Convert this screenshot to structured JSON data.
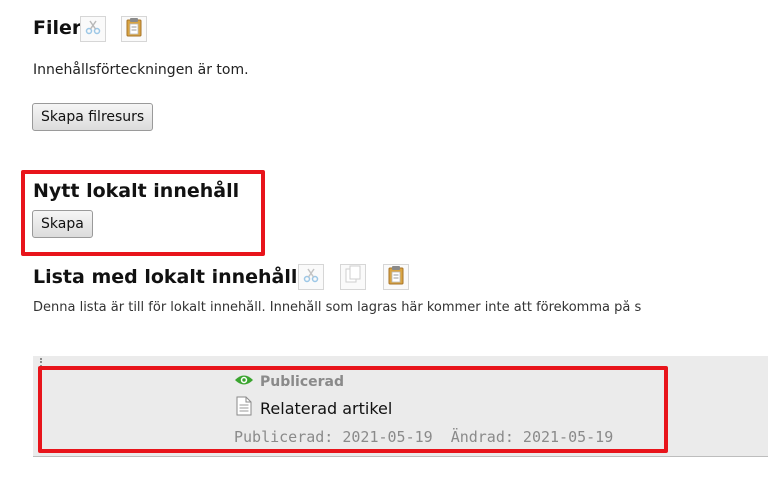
{
  "files": {
    "title": "Filer",
    "empty_text": "Innehållsförteckningen är tom.",
    "create_button": "Skapa filresurs"
  },
  "new_local": {
    "title": "Nytt lokalt innehåll",
    "create_button": "Skapa"
  },
  "local_list": {
    "title": "Lista med lokalt innehåll",
    "description": "Denna lista är till för lokalt innehåll. Innehåll som lagras här kommer inte att förekomma på s",
    "item": {
      "status": "Publicerad",
      "title": "Relaterad artikel",
      "published": "Publicerad: 2021-05-19",
      "modified": "Ändrad: 2021-05-19"
    }
  },
  "icons": {
    "cut": "scissors-icon",
    "copy": "copy-icon",
    "paste": "clipboard-icon",
    "status": "eye-icon",
    "document": "document-icon"
  },
  "colors": {
    "highlight": "#e8141b",
    "published_green": "#3ba52f",
    "panel_bg": "#ebebeb"
  }
}
